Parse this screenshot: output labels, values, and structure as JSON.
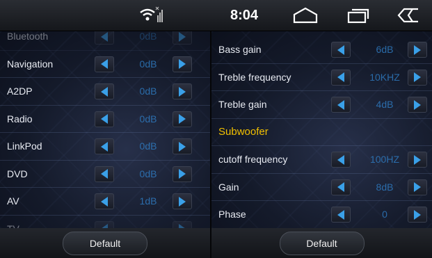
{
  "status_bar": {
    "time": "8:04",
    "icons": [
      "wifi-signal-icon",
      "home-icon",
      "recent-apps-icon",
      "back-icon"
    ]
  },
  "left_panel": {
    "rows": [
      {
        "label": "Bluetooth",
        "value": "0dB"
      },
      {
        "label": "Navigation",
        "value": "0dB"
      },
      {
        "label": "A2DP",
        "value": "0dB"
      },
      {
        "label": "Radio",
        "value": "0dB"
      },
      {
        "label": "LinkPod",
        "value": "0dB"
      },
      {
        "label": "DVD",
        "value": "0dB"
      },
      {
        "label": "AV",
        "value": "1dB"
      },
      {
        "label": "TV",
        "value": ""
      }
    ],
    "default_label": "Default"
  },
  "right_panel": {
    "rows": [
      {
        "label": "Bass gain",
        "value": "6dB"
      },
      {
        "label": "Treble frequency",
        "value": "10KHZ"
      },
      {
        "label": "Treble gain",
        "value": "4dB"
      },
      {
        "label": "Subwoofer",
        "section": true
      },
      {
        "label": "cutoff frequency",
        "value": "100HZ"
      },
      {
        "label": "Gain",
        "value": "8dB"
      },
      {
        "label": "Phase",
        "value": "0"
      }
    ],
    "default_label": "Default"
  },
  "colors": {
    "accent_blue": "#3aa0e8",
    "section_yellow": "#f2c000",
    "value_blue": "#2f7fc8"
  }
}
